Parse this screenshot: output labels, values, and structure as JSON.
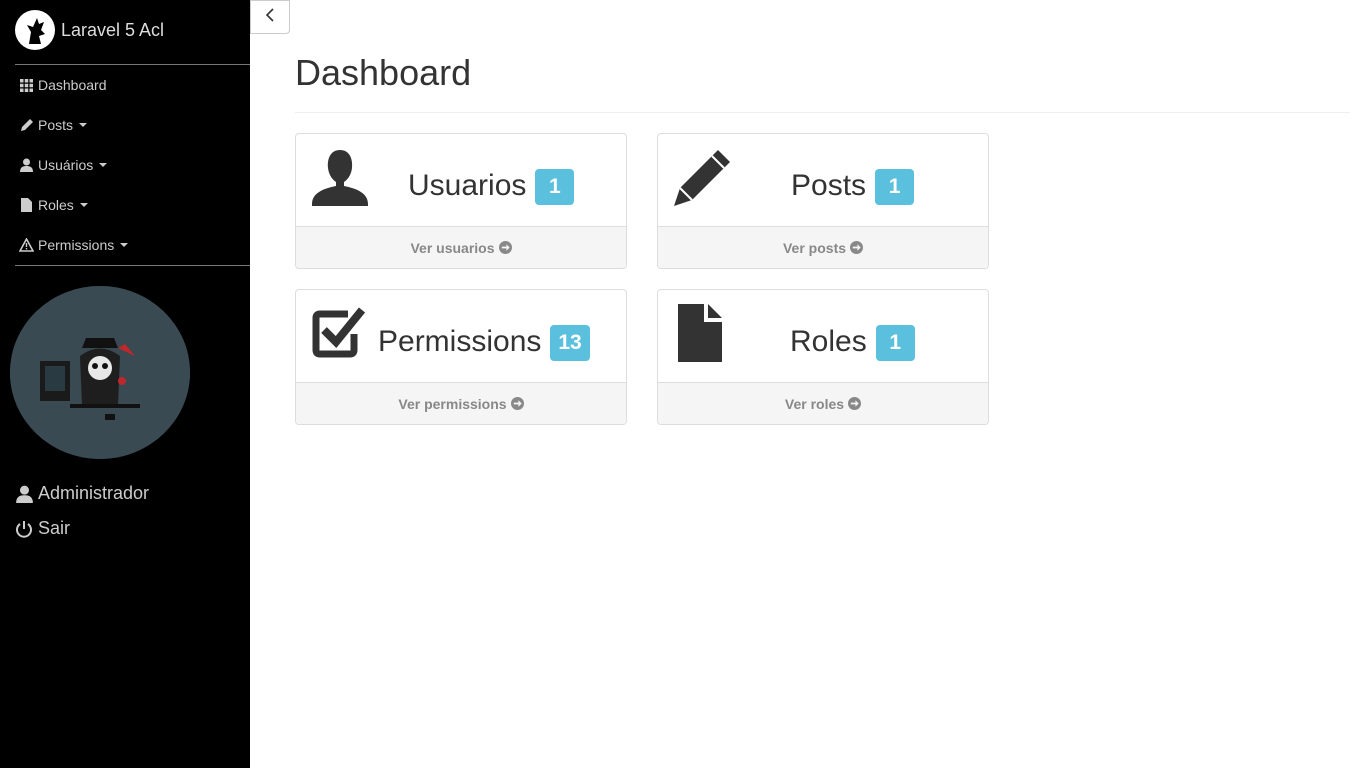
{
  "app": {
    "brand": "Laravel 5 Acl"
  },
  "sidebar": {
    "items": [
      {
        "label": "Dashboard",
        "icon": "grid-icon"
      },
      {
        "label": "Posts",
        "icon": "pencil-icon"
      },
      {
        "label": "Usuários",
        "icon": "user-icon"
      },
      {
        "label": "Roles",
        "icon": "file-icon"
      },
      {
        "label": "Permissions",
        "icon": "warning-icon"
      }
    ],
    "user_name": "Administrador",
    "logout_label": "Sair"
  },
  "main": {
    "title": "Dashboard",
    "cards": [
      {
        "title": "Usuarios",
        "count": "1",
        "link": "Ver usuarios",
        "icon": "user-icon"
      },
      {
        "title": "Posts",
        "count": "1",
        "link": "Ver posts",
        "icon": "pencil-icon"
      },
      {
        "title": "Permissions",
        "count": "13",
        "link": "Ver permissions",
        "icon": "check-square-icon"
      },
      {
        "title": "Roles",
        "count": "1",
        "link": "Ver roles",
        "icon": "file-icon"
      }
    ]
  },
  "colors": {
    "sidebar_bg": "#000000",
    "badge": "#5bc0de",
    "panel_footer": "#f5f5f5"
  }
}
